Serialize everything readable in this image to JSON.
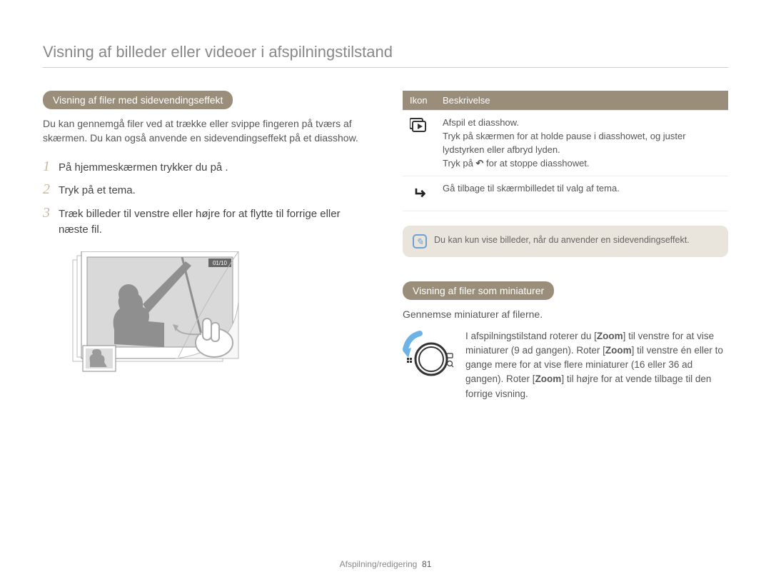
{
  "header": "Visning af billeder eller videoer i afspilningstilstand",
  "left": {
    "pill": "Visning af filer med sidevendingseffekt",
    "paragraph": "Du kan gennemgå filer ved at trække eller svippe fingeren på tværs af skærmen. Du kan også anvende en sidevendingseffekt på et diasshow.",
    "steps": [
      "På hjemmeskærmen trykker du på     .",
      "Tryk på et tema.",
      "Træk billeder til venstre eller højre for at flytte til forrige eller næste fil."
    ],
    "illus_counter": "01/10"
  },
  "right": {
    "table": {
      "header_icon": "Ikon",
      "header_desc": "Beskrivelse",
      "rows": [
        {
          "icon": "slide-play-icon",
          "desc_1": "Afspil et diasshow.",
          "desc_2": "Tryk på skærmen for at holde pause i diasshowet, og juster lydstyrken eller afbryd lyden.",
          "desc_3_pre": "Tryk på ",
          "desc_3_post": " for at stoppe diasshowet."
        },
        {
          "icon": "return-icon",
          "desc_1": "Gå tilbage til skærmbilledet til valg af tema."
        }
      ]
    },
    "note": "Du kan kun vise billeder, når du anvender en sidevendingseffekt.",
    "pill2": "Visning af filer som miniaturer",
    "pill2_sub": "Gennemse miniaturer af filerne.",
    "zoom": {
      "t1": "I afspilningstilstand roterer du [",
      "b1": "Zoom",
      "t2": "] til venstre for at vise miniaturer (9 ad gangen). Roter [",
      "b2": "Zoom",
      "t3": "] til venstre én eller to gange mere for at vise flere miniaturer (16 eller 36 ad gangen). Roter [",
      "b3": "Zoom",
      "t4": "] til højre for at vende tilbage til den forrige visning."
    }
  },
  "footer": {
    "section": "Afspilning/redigering",
    "page": "81"
  }
}
